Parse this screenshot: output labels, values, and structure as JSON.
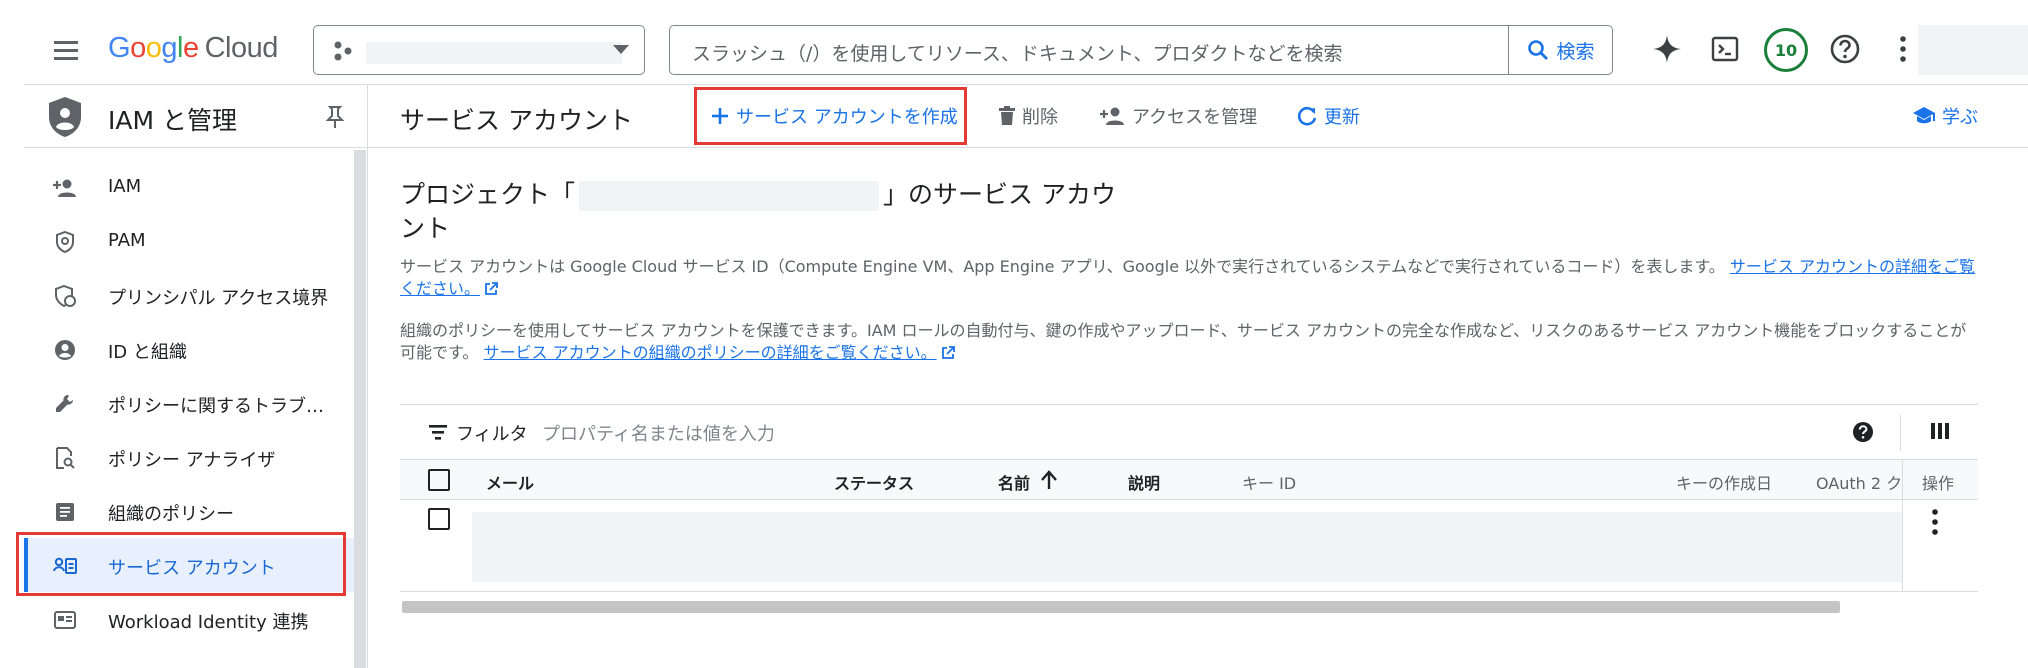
{
  "header": {
    "brand_google": "Google",
    "brand_cloud": "Cloud",
    "search_placeholder": "スラッシュ（/）を使用してリソース、ドキュメント、プロダクトなどを検索",
    "search_button": "検索",
    "notification_count": "10"
  },
  "sidebar": {
    "title": "IAM と管理",
    "items": [
      {
        "label": "IAM",
        "icon": "person-add-icon"
      },
      {
        "label": "PAM",
        "icon": "shield-check-icon"
      },
      {
        "label": "プリンシパル アクセス境界",
        "icon": "boundary-shield-icon"
      },
      {
        "label": "ID と組織",
        "icon": "account-circle-icon"
      },
      {
        "label": "ポリシーに関するトラブ…",
        "icon": "wrench-icon"
      },
      {
        "label": "ポリシー アナライザ",
        "icon": "document-search-icon"
      },
      {
        "label": "組織のポリシー",
        "icon": "list-document-icon"
      },
      {
        "label": "サービス アカウント",
        "icon": "service-account-icon",
        "active": true
      },
      {
        "label": "Workload Identity 連携",
        "icon": "id-card-icon"
      }
    ]
  },
  "toolbar": {
    "page_title": "サービス アカウント",
    "create_label": "サービス アカウントを作成",
    "delete_label": "削除",
    "manage_access_label": "アクセスを管理",
    "refresh_label": "更新",
    "learn_label": "学ぶ"
  },
  "content": {
    "heading_prefix": "プロジェクト「",
    "heading_suffix": "」のサービス アカウント",
    "para1_text": "サービス アカウントは Google Cloud サービス ID（Compute Engine VM、App Engine アプリ、Google 以外で実行されているシステムなどで実行されているコード）を表します。",
    "para1_link": "サービス アカウントの詳細をご覧ください。",
    "para2_text": "組織のポリシーを使用してサービス アカウントを保護できます。IAM ロールの自動付与、鍵の作成やアップロード、サービス アカウントの完全な作成など、リスクのあるサービス アカウント機能をブロックすることが可能です。",
    "para2_link": "サービス アカウントの組織のポリシーの詳細をご覧ください。"
  },
  "table": {
    "filter_label": "フィルタ",
    "filter_placeholder": "プロパティ名または値を入力",
    "columns": {
      "email": "メール",
      "status": "ステータス",
      "name": "名前",
      "description": "説明",
      "key_id": "キー ID",
      "key_created": "キーの作成日",
      "oauth": "OAuth 2 ク",
      "actions": "操作"
    }
  },
  "colors": {
    "accent": "#1a73e8",
    "highlight": "#e53935",
    "active_bg": "#e8f0fe"
  }
}
